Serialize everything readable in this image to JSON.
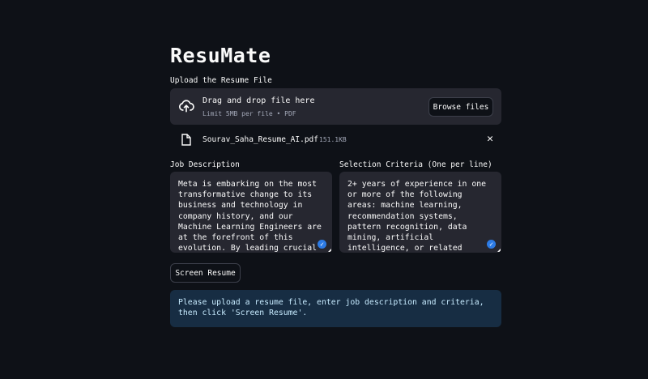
{
  "app": {
    "title": "ResuMate"
  },
  "upload": {
    "label": "Upload the Resume File",
    "drop_title": "Drag and drop file here",
    "drop_subtitle": "Limit 5MB per file • PDF",
    "browse_label": "Browse files",
    "file": {
      "name": "Sourav_Saha_Resume_AI.pdf",
      "size": "151.1KB"
    }
  },
  "job_description": {
    "label": "Job Description",
    "value": "Meta is embarking on the most transformative change to its business and technology in company history, and our Machine Learning Engineers are at the forefront of this evolution. By leading crucial"
  },
  "criteria": {
    "label": "Selection Criteria (One per line)",
    "value": "2+ years of experience in one or more of the following areas: machine learning, recommendation systems, pattern recognition, data mining, artificial intelligence, or related technical field\\n"
  },
  "actions": {
    "screen_label": "Screen Resume"
  },
  "info": {
    "message": "Please upload a resume file, enter job description and criteria, then click 'Screen Resume'."
  },
  "colors": {
    "background": "#0e1117",
    "surface": "#262730",
    "info_bg": "#172d43",
    "info_text": "#c7ebff"
  }
}
